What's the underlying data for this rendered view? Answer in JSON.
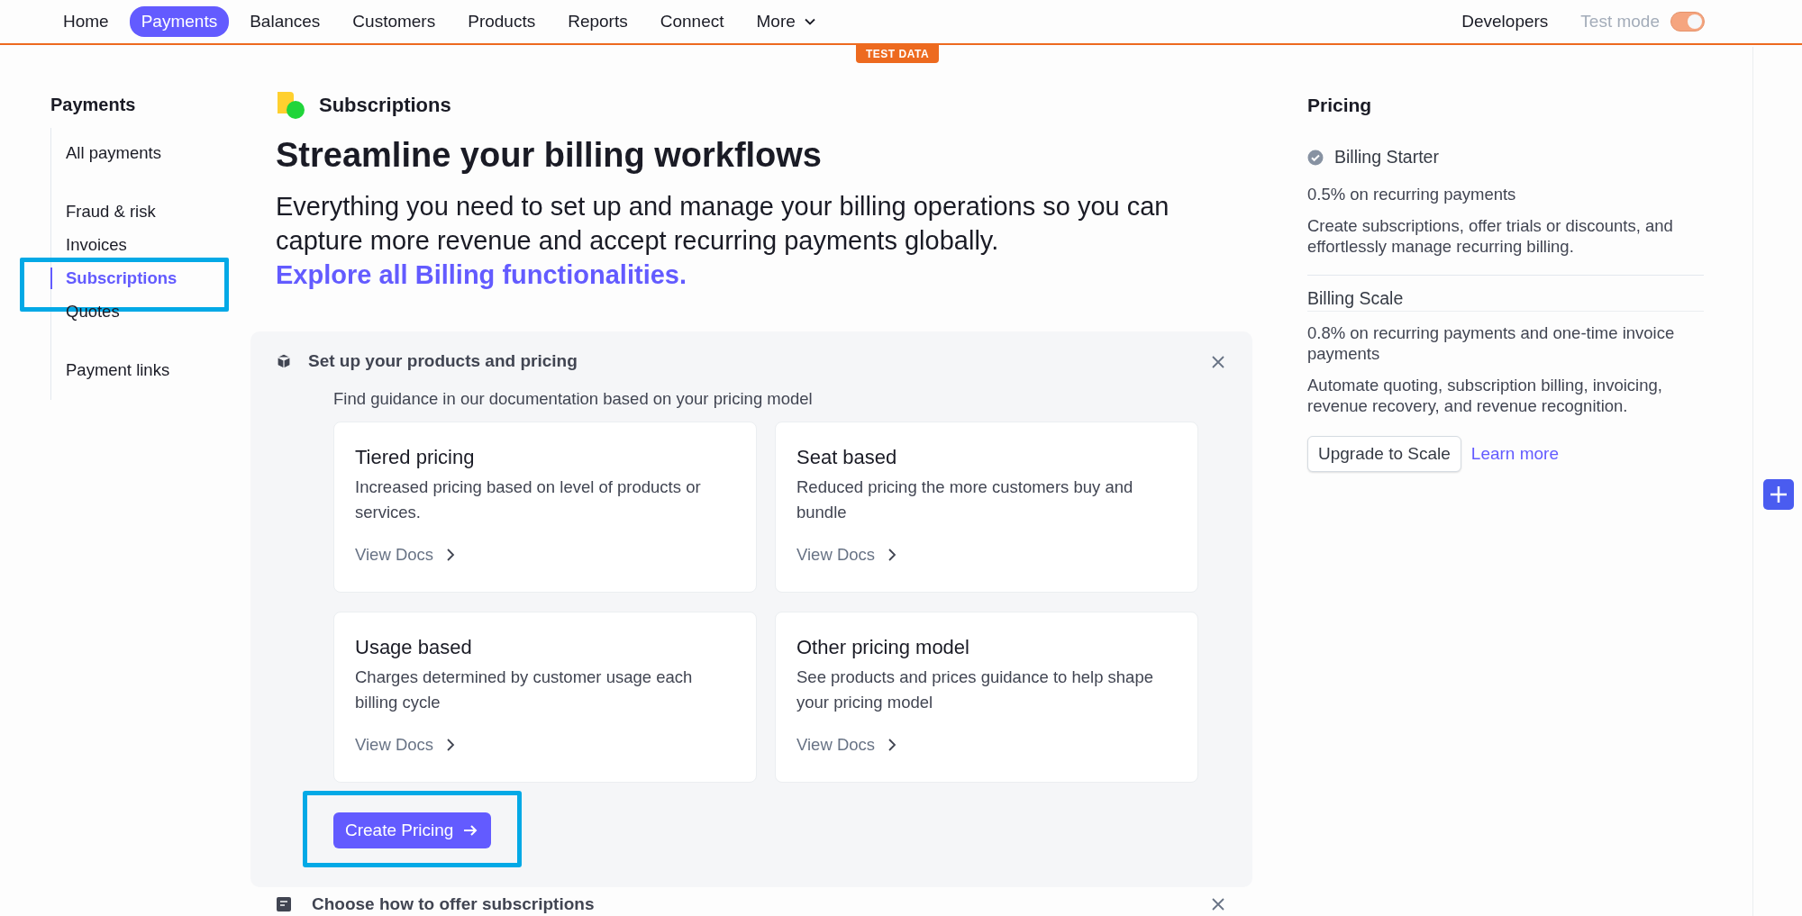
{
  "nav": {
    "items": [
      {
        "label": "Home",
        "selected": false
      },
      {
        "label": "Payments",
        "selected": true
      },
      {
        "label": "Balances",
        "selected": false
      },
      {
        "label": "Customers",
        "selected": false
      },
      {
        "label": "Products",
        "selected": false
      },
      {
        "label": "Reports",
        "selected": false
      },
      {
        "label": "Connect",
        "selected": false
      }
    ],
    "more": "More",
    "developers": "Developers",
    "test_mode": {
      "label": "Test mode",
      "on": true
    },
    "badge": "TEST DATA"
  },
  "sidebar": {
    "title": "Payments",
    "groups": [
      {
        "items": [
          {
            "label": "All payments",
            "selected": false,
            "highlighted": false
          }
        ]
      },
      {
        "items": [
          {
            "label": "Fraud & risk",
            "selected": false,
            "highlighted": false
          },
          {
            "label": "Invoices",
            "selected": false,
            "highlighted": false
          },
          {
            "label": "Subscriptions",
            "selected": true,
            "highlighted": true
          },
          {
            "label": "Quotes",
            "selected": false,
            "highlighted": false
          }
        ]
      },
      {
        "items": [
          {
            "label": "Payment links",
            "selected": false,
            "highlighted": false
          }
        ]
      }
    ]
  },
  "page": {
    "section": "Subscriptions",
    "title": "Streamline your billing workflows",
    "intro": "Everything you need to set up and manage your billing operations so you can capture more revenue and accept recurring payments globally.",
    "intro_link": "Explore all Billing functionalities."
  },
  "setup": {
    "title": "Set up your products and pricing",
    "subtitle": "Find guidance in our documentation based on your pricing model",
    "cards": [
      {
        "title": "Tiered pricing",
        "description": "Increased pricing based on level of products or services.",
        "link": "View Docs"
      },
      {
        "title": "Seat based",
        "description": "Reduced pricing the more customers buy and bundle",
        "link": "View Docs"
      },
      {
        "title": "Usage based",
        "description": "Charges determined by customer usage each billing cycle",
        "link": "View Docs"
      },
      {
        "title": "Other pricing model",
        "description": "See products and prices guidance to help shape your pricing model",
        "link": "View Docs"
      }
    ],
    "button": {
      "label": "Create Pricing",
      "highlighted": true
    }
  },
  "next_section": {
    "title": "Choose how to offer subscriptions"
  },
  "pricing": {
    "title": "Pricing",
    "plans": [
      {
        "name": "Billing Starter",
        "current": true,
        "rate": "0.5% on recurring payments",
        "description": "Create subscriptions, offer trials or discounts, and effortlessly manage recurring billing."
      },
      {
        "name": "Billing Scale",
        "current": false,
        "rate": "0.8% on recurring payments and one-time invoice payments",
        "description": "Automate quoting, subscription billing, invoicing, revenue recovery, and revenue recognition."
      }
    ],
    "upgrade_button": "Upgrade to Scale",
    "learn_more": "Learn more"
  }
}
